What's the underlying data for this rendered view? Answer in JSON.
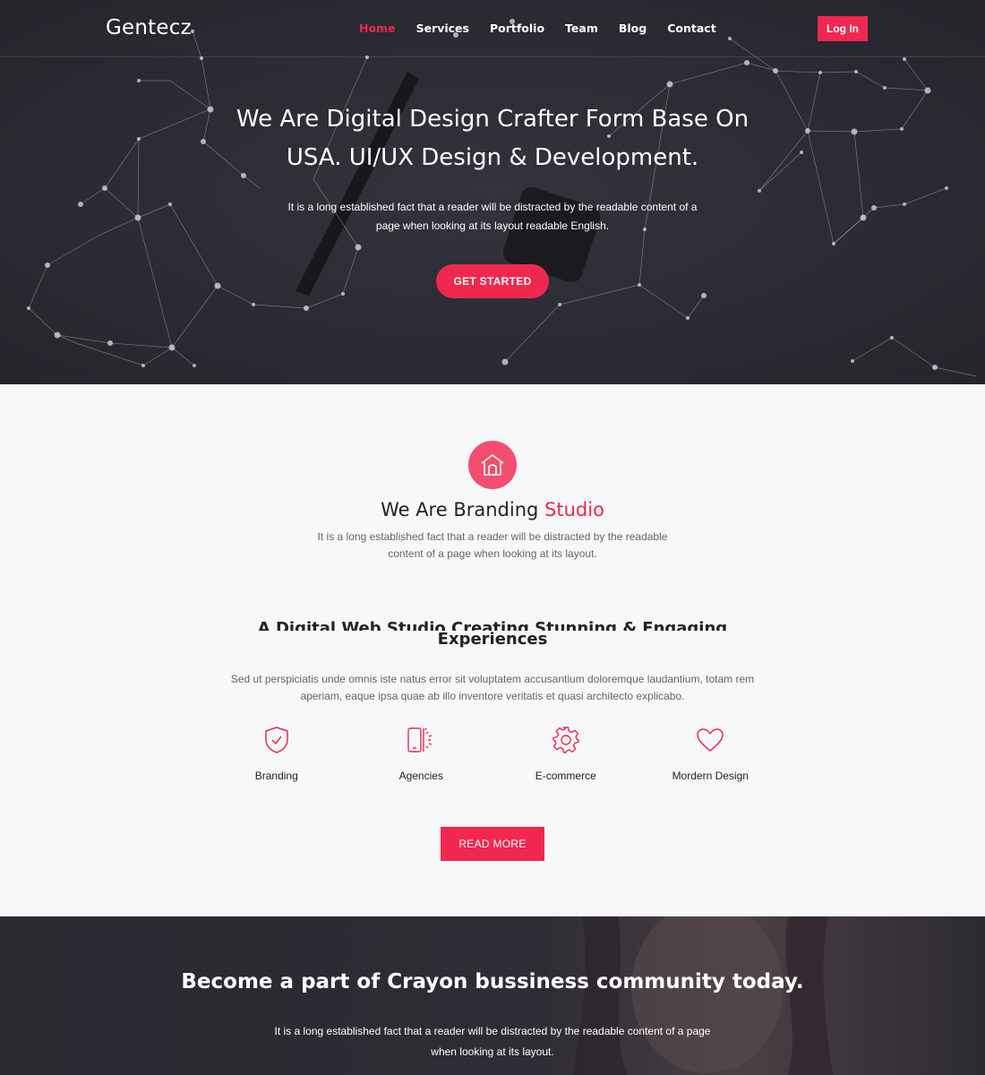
{
  "header": {
    "logo": "Gentecz",
    "nav": [
      {
        "label": "Home",
        "active": true
      },
      {
        "label": "Services",
        "active": false
      },
      {
        "label": "Portfolio",
        "active": false
      },
      {
        "label": "Team",
        "active": false
      },
      {
        "label": "Blog",
        "active": false
      },
      {
        "label": "Contact",
        "active": false
      }
    ],
    "login_label": "Log In"
  },
  "hero": {
    "title_line1": "We Are Digital Design Crafter Form Base On",
    "title_line2": "USA. UI/UX Design & Development.",
    "subtitle": "It is a long established fact that a reader will be distracted by the readable content of a page when looking at its layout readable English.",
    "button_label": "GET STARTED"
  },
  "branding": {
    "icon": "house-icon",
    "title_prefix": "We Are Branding ",
    "title_accent": "Studio",
    "subtitle": "It is a long established fact that a reader will be distracted by the readable content of a page when looking at its layout.",
    "studio_title_line1": "A Digital Web Studio Creating Stunning & Engaging Online",
    "studio_title_line2": "Experiences",
    "studio_subtitle": "Sed ut perspiciatis unde omnis iste natus error sit voluptatem accusantium doloremque laudantium, totam rem aperiam, eaque ipsa quae ab illo inventore veritatis et quasi architecto explicabo.",
    "features": [
      {
        "label": "Branding",
        "icon": "shield-check-icon"
      },
      {
        "label": "Agencies",
        "icon": "mobile-icon"
      },
      {
        "label": "E-commerce",
        "icon": "gear-icon"
      },
      {
        "label": "Mordern Design",
        "icon": "heart-icon"
      }
    ],
    "read_more_label": "READ MORE"
  },
  "cta": {
    "title": "Become a part of Crayon bussiness community today.",
    "subtitle": "It is a long established fact that a reader will be distracted by the readable content of a page when looking at its layout."
  },
  "colors": {
    "accent": "#f0284f",
    "hero_bg": "#2b2b33",
    "section_bg": "#f7f8fa"
  }
}
